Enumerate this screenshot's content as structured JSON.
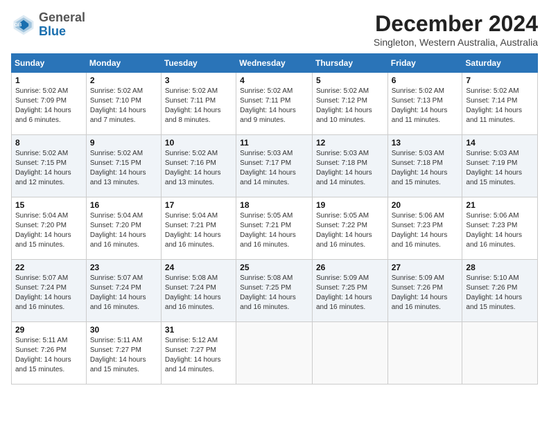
{
  "header": {
    "logo_general": "General",
    "logo_blue": "Blue",
    "month": "December 2024",
    "location": "Singleton, Western Australia, Australia"
  },
  "days_of_week": [
    "Sunday",
    "Monday",
    "Tuesday",
    "Wednesday",
    "Thursday",
    "Friday",
    "Saturday"
  ],
  "weeks": [
    [
      {
        "day": "1",
        "sunrise": "5:02 AM",
        "sunset": "7:09 PM",
        "daylight": "14 hours and 6 minutes."
      },
      {
        "day": "2",
        "sunrise": "5:02 AM",
        "sunset": "7:10 PM",
        "daylight": "14 hours and 7 minutes."
      },
      {
        "day": "3",
        "sunrise": "5:02 AM",
        "sunset": "7:11 PM",
        "daylight": "14 hours and 8 minutes."
      },
      {
        "day": "4",
        "sunrise": "5:02 AM",
        "sunset": "7:11 PM",
        "daylight": "14 hours and 9 minutes."
      },
      {
        "day": "5",
        "sunrise": "5:02 AM",
        "sunset": "7:12 PM",
        "daylight": "14 hours and 10 minutes."
      },
      {
        "day": "6",
        "sunrise": "5:02 AM",
        "sunset": "7:13 PM",
        "daylight": "14 hours and 11 minutes."
      },
      {
        "day": "7",
        "sunrise": "5:02 AM",
        "sunset": "7:14 PM",
        "daylight": "14 hours and 11 minutes."
      }
    ],
    [
      {
        "day": "8",
        "sunrise": "5:02 AM",
        "sunset": "7:15 PM",
        "daylight": "14 hours and 12 minutes."
      },
      {
        "day": "9",
        "sunrise": "5:02 AM",
        "sunset": "7:15 PM",
        "daylight": "14 hours and 13 minutes."
      },
      {
        "day": "10",
        "sunrise": "5:02 AM",
        "sunset": "7:16 PM",
        "daylight": "14 hours and 13 minutes."
      },
      {
        "day": "11",
        "sunrise": "5:03 AM",
        "sunset": "7:17 PM",
        "daylight": "14 hours and 14 minutes."
      },
      {
        "day": "12",
        "sunrise": "5:03 AM",
        "sunset": "7:18 PM",
        "daylight": "14 hours and 14 minutes."
      },
      {
        "day": "13",
        "sunrise": "5:03 AM",
        "sunset": "7:18 PM",
        "daylight": "14 hours and 15 minutes."
      },
      {
        "day": "14",
        "sunrise": "5:03 AM",
        "sunset": "7:19 PM",
        "daylight": "14 hours and 15 minutes."
      }
    ],
    [
      {
        "day": "15",
        "sunrise": "5:04 AM",
        "sunset": "7:20 PM",
        "daylight": "14 hours and 15 minutes."
      },
      {
        "day": "16",
        "sunrise": "5:04 AM",
        "sunset": "7:20 PM",
        "daylight": "14 hours and 16 minutes."
      },
      {
        "day": "17",
        "sunrise": "5:04 AM",
        "sunset": "7:21 PM",
        "daylight": "14 hours and 16 minutes."
      },
      {
        "day": "18",
        "sunrise": "5:05 AM",
        "sunset": "7:21 PM",
        "daylight": "14 hours and 16 minutes."
      },
      {
        "day": "19",
        "sunrise": "5:05 AM",
        "sunset": "7:22 PM",
        "daylight": "14 hours and 16 minutes."
      },
      {
        "day": "20",
        "sunrise": "5:06 AM",
        "sunset": "7:23 PM",
        "daylight": "14 hours and 16 minutes."
      },
      {
        "day": "21",
        "sunrise": "5:06 AM",
        "sunset": "7:23 PM",
        "daylight": "14 hours and 16 minutes."
      }
    ],
    [
      {
        "day": "22",
        "sunrise": "5:07 AM",
        "sunset": "7:24 PM",
        "daylight": "14 hours and 16 minutes."
      },
      {
        "day": "23",
        "sunrise": "5:07 AM",
        "sunset": "7:24 PM",
        "daylight": "14 hours and 16 minutes."
      },
      {
        "day": "24",
        "sunrise": "5:08 AM",
        "sunset": "7:24 PM",
        "daylight": "14 hours and 16 minutes."
      },
      {
        "day": "25",
        "sunrise": "5:08 AM",
        "sunset": "7:25 PM",
        "daylight": "14 hours and 16 minutes."
      },
      {
        "day": "26",
        "sunrise": "5:09 AM",
        "sunset": "7:25 PM",
        "daylight": "14 hours and 16 minutes."
      },
      {
        "day": "27",
        "sunrise": "5:09 AM",
        "sunset": "7:26 PM",
        "daylight": "14 hours and 16 minutes."
      },
      {
        "day": "28",
        "sunrise": "5:10 AM",
        "sunset": "7:26 PM",
        "daylight": "14 hours and 15 minutes."
      }
    ],
    [
      {
        "day": "29",
        "sunrise": "5:11 AM",
        "sunset": "7:26 PM",
        "daylight": "14 hours and 15 minutes."
      },
      {
        "day": "30",
        "sunrise": "5:11 AM",
        "sunset": "7:27 PM",
        "daylight": "14 hours and 15 minutes."
      },
      {
        "day": "31",
        "sunrise": "5:12 AM",
        "sunset": "7:27 PM",
        "daylight": "14 hours and 14 minutes."
      },
      null,
      null,
      null,
      null
    ]
  ]
}
